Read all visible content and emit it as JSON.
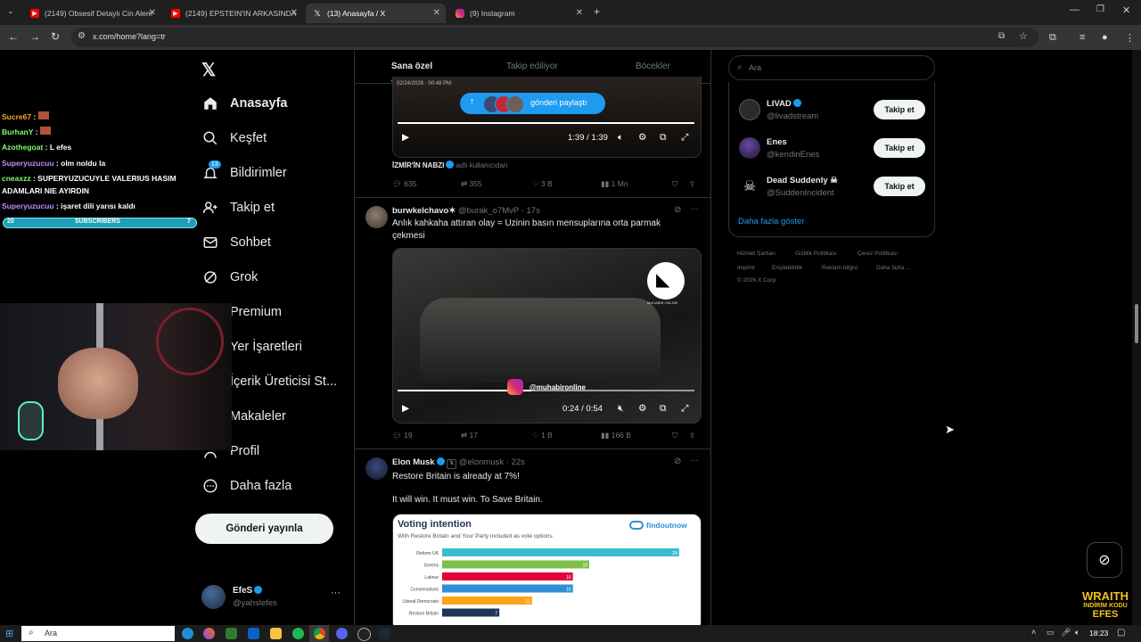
{
  "browser": {
    "tabs": [
      {
        "title": "(2149) Obsesif Detaylı Cin Alem",
        "icon": "youtube-icon"
      },
      {
        "title": "(2149) EPSTEIN'IN ARKASINDA",
        "icon": "youtube-icon"
      },
      {
        "title": "(13) Anasayfa / X",
        "icon": "x-icon",
        "active": true
      },
      {
        "title": "(9) Instagram",
        "icon": "instagram-icon"
      }
    ],
    "url": "x.com/home?lang=tr"
  },
  "nav": {
    "items": [
      {
        "label": "Anasayfa",
        "icon": "home-icon",
        "bold": true
      },
      {
        "label": "Keşfet",
        "icon": "search-icon"
      },
      {
        "label": "Bildirimler",
        "icon": "bell-icon",
        "badge": "13"
      },
      {
        "label": "Takip et",
        "icon": "person-add-icon"
      },
      {
        "label": "Sohbet",
        "icon": "mail-icon"
      },
      {
        "label": "Grok",
        "icon": "grok-icon"
      },
      {
        "label": "Premium",
        "icon": "x-premium-icon"
      },
      {
        "label": "Yer İşaretleri",
        "icon": "bookmark-icon"
      },
      {
        "label": "İçerik Üreticisi St...",
        "icon": "studio-icon"
      },
      {
        "label": "Makaleler",
        "icon": "article-icon"
      },
      {
        "label": "Profil",
        "icon": "profile-icon"
      },
      {
        "label": "Daha fazla",
        "icon": "more-circle-icon"
      }
    ],
    "post_button": "Gönderi yayınla",
    "account": {
      "name": "EfeS",
      "handle": "@yahslefes"
    }
  },
  "feed": {
    "tabs": [
      "Sana özel",
      "Takip ediliyor",
      "Böcekler"
    ],
    "share_pill": "gönderi paylaştı",
    "post1": {
      "date_fragment": "02/24/2026 · 00:48 PM",
      "time": "1:39 / 1:39",
      "source_name": "İZMİR'İN NABZI",
      "source_sub": "adlı kullanıcıdan",
      "replies": "635",
      "reposts": "355",
      "likes": "3 B",
      "views": "1 Mn"
    },
    "post2": {
      "name": "burwkelchavo✶",
      "handle": "@burak_o7MvP",
      "time": "17s",
      "text": "Anlık kahkaha attıran olay = Uzinin basın mensuplarına orta parmak çekmesi",
      "watermark": "MUHABIR ONLINE",
      "ig_handle": "@muhabironline",
      "video_time": "0:24 / 0:54",
      "replies": "19",
      "reposts": "17",
      "likes": "1 B",
      "views": "166 B"
    },
    "post3": {
      "name": "Elon Musk",
      "handle": "@elonmusk",
      "time": "22s",
      "line1": "Restore Britain is already at 7%!",
      "line2": "It will win. It must win. To Save Britain.",
      "card_title": "Voting intention",
      "card_subtitle": "With Restore Britain and Your Party included as vote options",
      "card_brand": "findoutnow"
    }
  },
  "chart_data": {
    "type": "bar",
    "title": "Voting intention",
    "subtitle": "With Restore Britain and Your Party included as vote options",
    "categories": [
      "Reform UK",
      "Greens",
      "Labour",
      "Conservatives",
      "Liberal Democrats",
      "Restore Britain"
    ],
    "values": [
      29,
      18,
      16,
      16,
      11,
      7
    ],
    "colors": [
      "#38bdd1",
      "#7cc04a",
      "#e4003b",
      "#2f8fd6",
      "#faa61a",
      "#1d3557"
    ],
    "xlim": [
      0,
      30
    ]
  },
  "right": {
    "search_placeholder": "Ara",
    "who_to_follow": [
      {
        "name": "LIVAD",
        "handle": "@livadstream",
        "verified": true,
        "button": "Takip et"
      },
      {
        "name": "Enes",
        "handle": "@kendinEnes",
        "verified": false,
        "button": "Takip et"
      },
      {
        "name": "Dead Suddenly ☠",
        "handle": "@SuddenIncident",
        "verified": false,
        "button": "Takip et"
      }
    ],
    "show_more": "Daha fazla göster",
    "footer_row1": [
      "Hizmet Şartları",
      "Gizlilik Politikası",
      "Çerez Politikası"
    ],
    "footer_row2": [
      "Imprint",
      "Erişilebilirlik",
      "Reklam bilgisi",
      "Daha fazla ..."
    ],
    "copyright": "© 2026 X Corp."
  },
  "stream": {
    "chat": [
      {
        "user": "Sucre67",
        "msg": ":",
        "color": "#f5a623"
      },
      {
        "user": "BurhanY",
        "msg": ":",
        "color": "#7cff6b"
      },
      {
        "user": "Azothegoat",
        "msg": ": L efes",
        "color": "#7cff6b"
      },
      {
        "user": "Superyuzucuu",
        "msg": ": olm noldu la",
        "color": "#c28cff"
      },
      {
        "user": "cneaxzz",
        "msg": ": SUPERYUZUCUYLE VALERIUS HASIM ADAMLARI NIE AYIRDIN",
        "color": "#7cff6b"
      },
      {
        "user": "Superyuzucuu",
        "msg": ": işaret dili yarısı kaldı",
        "color": "#c28cff"
      }
    ],
    "sub_bar": {
      "left": "20",
      "label": "SUBSCRIBERS",
      "right": "7"
    },
    "watermark_line1": "WRAITH",
    "watermark_line2": "İNDİRİM KODU",
    "watermark_line3": "EFES"
  },
  "taskbar": {
    "search": "Ara",
    "clock": "18:23"
  }
}
